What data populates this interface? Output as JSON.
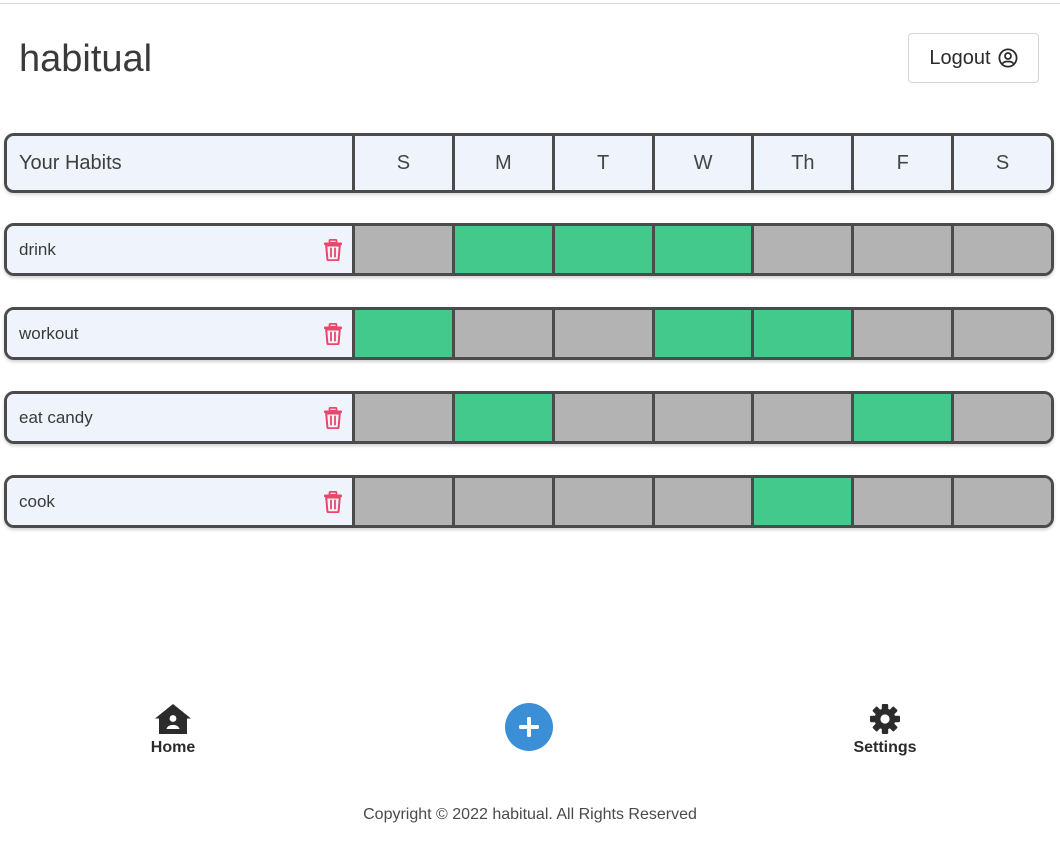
{
  "header": {
    "title": "habitual",
    "logout_label": "Logout"
  },
  "grid": {
    "header_label": "Your Habits",
    "days": [
      "S",
      "M",
      "T",
      "W",
      "Th",
      "F",
      "S"
    ]
  },
  "habits": [
    {
      "name": "drink",
      "done": [
        false,
        true,
        true,
        true,
        false,
        false,
        false
      ]
    },
    {
      "name": "workout",
      "done": [
        true,
        false,
        false,
        true,
        true,
        false,
        false
      ]
    },
    {
      "name": "eat candy",
      "done": [
        false,
        true,
        false,
        false,
        false,
        true,
        false
      ]
    },
    {
      "name": "cook",
      "done": [
        false,
        false,
        false,
        false,
        true,
        false,
        false
      ]
    }
  ],
  "nav": {
    "home_label": "Home",
    "settings_label": "Settings"
  },
  "footer": {
    "copyright": "Copyright © 2022 habitual. All Rights Reserved"
  },
  "colors": {
    "done": "#44c98c",
    "not_done": "#b3b3b3",
    "trash": "#e8476a",
    "accent": "#3a8fd6"
  },
  "icons": {
    "logout": "user-circle-icon",
    "delete": "trash-icon",
    "home": "home-icon",
    "add": "plus-circle-icon",
    "settings": "gear-icon"
  }
}
